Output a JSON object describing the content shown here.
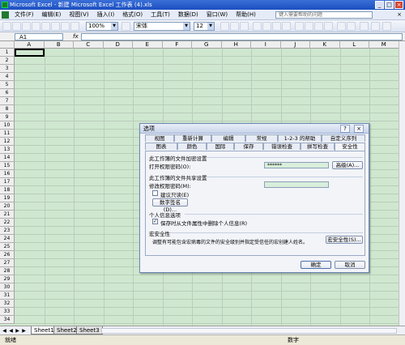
{
  "window": {
    "title": "Microsoft Excel - 新建 Microsoft Excel 工作表 (4).xls",
    "buttons": [
      "_",
      "□",
      "×"
    ]
  },
  "menubar": {
    "items": [
      "文件(F)",
      "编辑(E)",
      "视图(V)",
      "插入(I)",
      "格式(O)",
      "工具(T)",
      "数据(D)",
      "窗口(W)",
      "帮助(H)"
    ],
    "help_placeholder": "键入需要帮助的问题"
  },
  "toolbar": {
    "zoom": "100%",
    "font_name": "宋体",
    "font_size": "12"
  },
  "formula_bar": {
    "cell_ref": "A1",
    "fx": "fx"
  },
  "grid": {
    "columns": [
      "A",
      "B",
      "C",
      "D",
      "E",
      "F",
      "G",
      "H",
      "I",
      "J",
      "K",
      "L",
      "M"
    ],
    "rows": [
      "1",
      "2",
      "3",
      "4",
      "5",
      "6",
      "7",
      "8",
      "9",
      "10",
      "11",
      "12",
      "13",
      "14",
      "15",
      "16",
      "17",
      "18",
      "19",
      "20",
      "21",
      "22",
      "23",
      "24",
      "25",
      "26",
      "27",
      "28",
      "29",
      "30",
      "31",
      "32",
      "33",
      "34"
    ]
  },
  "sheets": {
    "tabs": [
      "Sheet1",
      "Sheet2",
      "Sheet3"
    ],
    "active": 0
  },
  "status": {
    "left": "就绪",
    "right": "数字"
  },
  "dialog": {
    "title": "选项",
    "title_buttons": [
      "?",
      "×"
    ],
    "tabs_row1": [
      "视图",
      "重新计算",
      "编辑",
      "常规",
      "1-2-3 的帮助",
      "自定义序列"
    ],
    "tabs_row2": [
      "图表",
      "颜色",
      "国际",
      "保存",
      "错误检查",
      "拼写检查",
      "安全性"
    ],
    "active_tab": "安全性",
    "encrypt_section": "此工作簿的文件加密设置",
    "open_password_label": "打开权限密码(O):",
    "open_password_value": "******",
    "advanced_button": "高级(A)...",
    "share_section": "此工作簿的文件共享设置",
    "modify_password_label": "修改权限密码(M):",
    "readonly_label": "建议只读(E)",
    "readonly_checked": false,
    "digital_signature_button": "数字签名(D)...",
    "privacy_section": "个人信息选项",
    "remove_info_label": "保存时从文件属性中删除个人信息(R)",
    "remove_info_checked": true,
    "macro_section": "宏安全性",
    "macro_text": "调整有可能包含宏病毒的文件的安全级别并指定受信任的宏创建人姓名。",
    "macro_button": "宏安全性(S)...",
    "ok_button": "确定",
    "cancel_button": "取消"
  }
}
